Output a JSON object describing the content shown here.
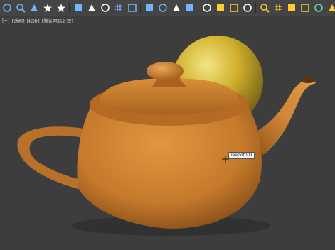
{
  "toolbar": {
    "tools": [
      {
        "name": "selection-filter-icon",
        "color": "#6fb8ff"
      },
      {
        "name": "select-object-icon",
        "color": "#6fb8ff"
      },
      {
        "name": "select-by-name-icon",
        "color": "#6fb8ff"
      },
      {
        "name": "select-and-move-icon",
        "color": "#ffffff"
      },
      {
        "name": "select-and-rotate-icon",
        "color": "#ffffff"
      },
      {
        "name": "snap-toggle-icon",
        "color": "#6fb8ff"
      },
      {
        "name": "angle-snap-icon",
        "color": "#ffffff"
      },
      {
        "name": "percent-snap-icon",
        "color": "#ffffff"
      },
      {
        "name": "mirror-icon",
        "color": "#6fb8ff"
      },
      {
        "name": "align-icon",
        "color": "#6fb8ff"
      },
      {
        "name": "layer-manager-icon",
        "color": "#6fb8ff"
      },
      {
        "name": "scene-explorer-icon",
        "color": "#6fb8ff"
      },
      {
        "name": "curve-editor-icon",
        "color": "#ffffff"
      },
      {
        "name": "schematic-view-icon",
        "color": "#6fb8ff"
      },
      {
        "name": "material-editor-icon",
        "color": "#ffffff"
      },
      {
        "name": "render-setup-icon",
        "color": "#ffcc33"
      },
      {
        "name": "render-frame-icon",
        "color": "#ffcc33"
      },
      {
        "name": "help-icon",
        "color": "#ffffff"
      },
      {
        "name": "zoom-icon",
        "color": "#ffcc33"
      },
      {
        "name": "grid-snap-icon",
        "color": "#ffcc33"
      },
      {
        "name": "field-of-view-icon",
        "color": "#ffcc33"
      },
      {
        "name": "pan-view-icon",
        "color": "#ffcc33"
      },
      {
        "name": "orbit-icon",
        "color": "#66ddaa"
      },
      {
        "name": "walkthrough-icon",
        "color": "#ffcc33"
      },
      {
        "name": "maximize-viewport-icon",
        "color": "#ffcc33"
      },
      {
        "name": "zoom-extents-icon",
        "color": "#ffcc33"
      }
    ]
  },
  "viewport": {
    "labels": [
      "[+]",
      "[透视]",
      "[标准]",
      "[默认明暗处理]"
    ],
    "tooltip": "Teapot001",
    "colors": {
      "background": "#3d3d3d",
      "teapot": "#c57a2c",
      "sphere": "#d6b42f"
    }
  }
}
